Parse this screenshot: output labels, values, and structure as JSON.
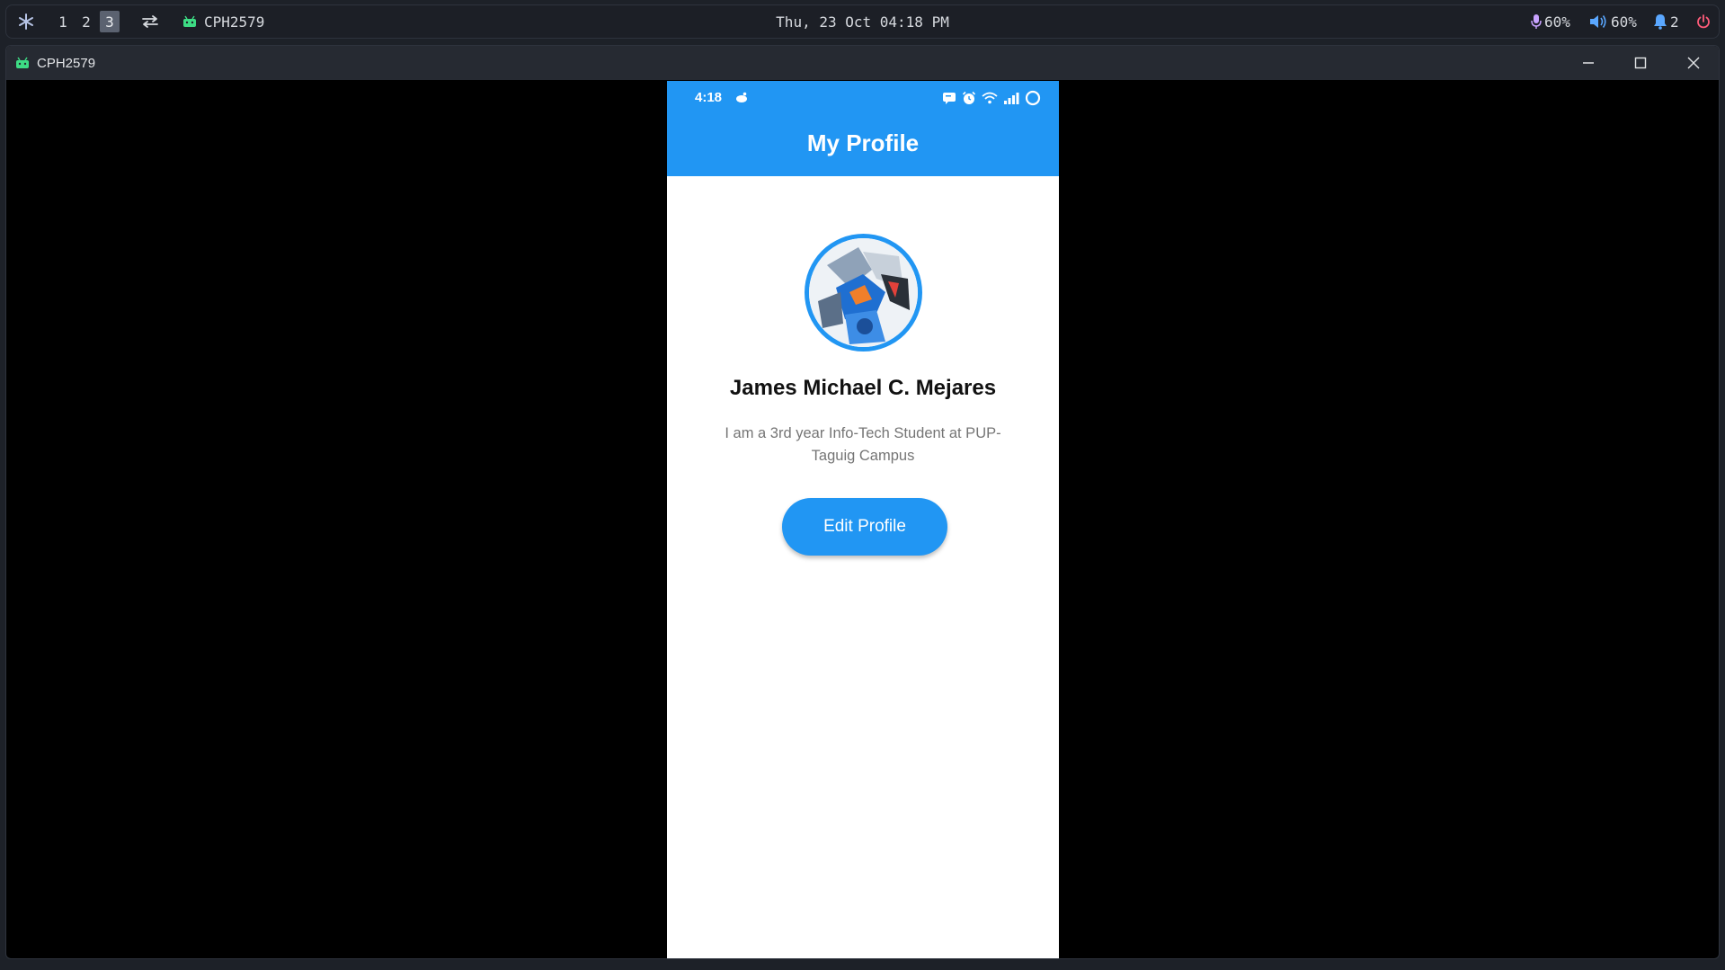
{
  "topbar": {
    "workspaces": [
      "1",
      "2",
      "3"
    ],
    "active_workspace": "3",
    "app_name": "CPH2579",
    "clock": "Thu, 23 Oct 04:18 PM",
    "mic_level": "60%",
    "volume_level": "60%",
    "notification_count": "2",
    "icons": [
      "nixos-snowflake-icon",
      "swap-icon",
      "android-icon",
      "mic-icon",
      "speaker-icon",
      "bell-icon",
      "power-icon"
    ]
  },
  "window": {
    "title": "CPH2579",
    "controls": [
      "minimize-icon",
      "maximize-icon",
      "close-icon"
    ]
  },
  "phone": {
    "status_time": "4:18",
    "appbar_title": "My Profile",
    "profile_name": "James Michael C. Mejares",
    "profile_bio": "I am a 3rd year Info-Tech Student at PUP-Taguig Campus",
    "edit_button": "Edit Profile"
  },
  "colors": {
    "accent": "#2196f3",
    "bar_bg": "#1c1f26",
    "titlebar_bg": "#262a32",
    "phone_bg": "#ffffff",
    "bio_text": "#757575",
    "mic_icon": "#c8a2ff",
    "speaker_icon": "#5aa7ff",
    "bell_icon": "#5aa7ff",
    "power_icon": "#ff5c7a"
  }
}
